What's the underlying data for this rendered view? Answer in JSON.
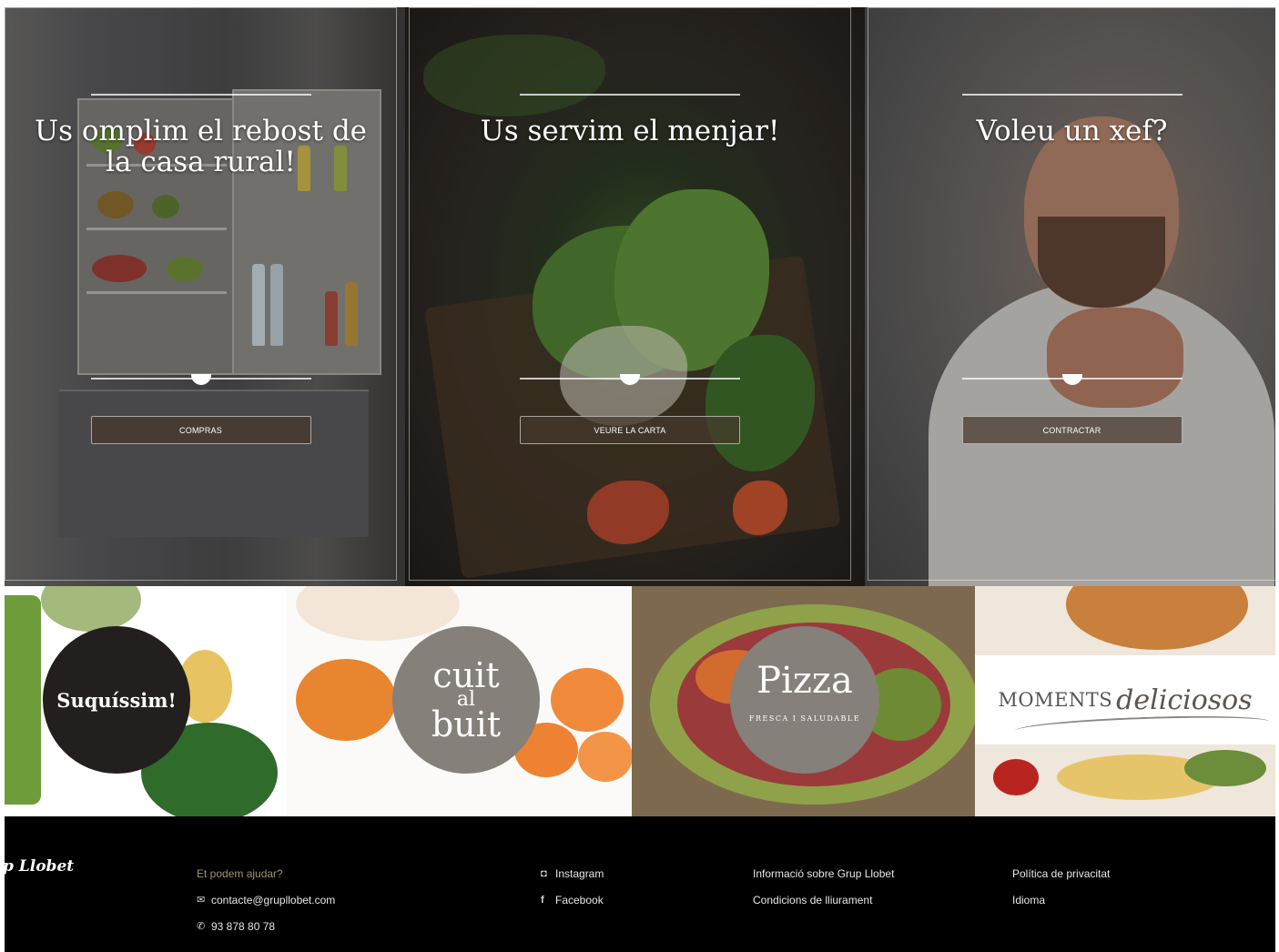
{
  "hero": {
    "cards": [
      {
        "title": "Us omplim el rebost de la casa rural!",
        "button": "COMPRAS"
      },
      {
        "title": "Us servim el menjar!",
        "button": "VEURE LA CARTA"
      },
      {
        "title": "Voleu un xef?",
        "button": "CONTRACTAR"
      }
    ]
  },
  "brands": {
    "suquissim": "Suquíssim!",
    "cuit_top": "cuit",
    "cuit_mid": "al",
    "cuit_bot": "buit",
    "pizza": "Pizza",
    "pizza_sub": "FRESCA I SALUDABLE",
    "moments": "MOMENTS",
    "moments_script": "deliciosos"
  },
  "footer": {
    "logo": "p Llobet",
    "help_title": "Et podem ajudar?",
    "email": "contacte@grupllobet.com",
    "phone": "93 878 80 78",
    "instagram": "Instagram",
    "facebook": "Facebook",
    "info": "Informació sobre Grup Llobet",
    "conditions": "Condicions de lliurament",
    "privacy": "Política de privacitat",
    "language": "Idioma"
  },
  "colors": {
    "footer_bg": "#000000",
    "accent_muted": "#9c9277",
    "badge_dark": "#231f1e",
    "badge_grey": "#858079"
  }
}
